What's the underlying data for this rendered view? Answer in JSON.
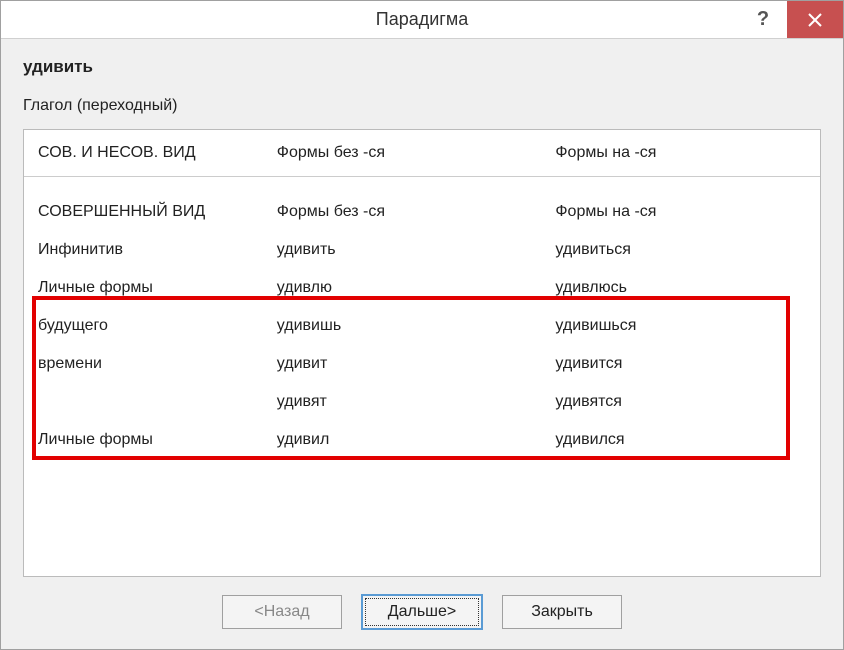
{
  "titlebar": {
    "title": "Парадигма",
    "help": "?",
    "close": "×"
  },
  "header": {
    "word": "удивить",
    "type": "Глагол (переходный)"
  },
  "table": {
    "header": {
      "col1": "СОВ. И НЕСОВ. ВИД",
      "col2": "Формы без -ся",
      "col3": "Формы на -ся"
    },
    "rows": [
      {
        "c1": "СОВЕРШЕННЫЙ ВИД",
        "c2": "Формы без -ся",
        "c3": "Формы на -ся"
      },
      {
        "c1": "Инфинитив",
        "c2": "удивить",
        "c3": "удивиться"
      },
      {
        "c1": "Личные формы",
        "c2": "удивлю",
        "c3": "удивлюсь"
      },
      {
        "c1": "будущего",
        "c2": "удивишь",
        "c3": "удивишься"
      },
      {
        "c1": "времени",
        "c2": "удивит",
        "c3": "удивится"
      },
      {
        "c1": "",
        "c2": "удивят",
        "c3": "удивятся"
      },
      {
        "c1": "Личные формы",
        "c2": "удивил",
        "c3": "удивился"
      }
    ]
  },
  "buttons": {
    "back": "<Назад",
    "next": "Дальше>",
    "close": "Закрыть"
  }
}
